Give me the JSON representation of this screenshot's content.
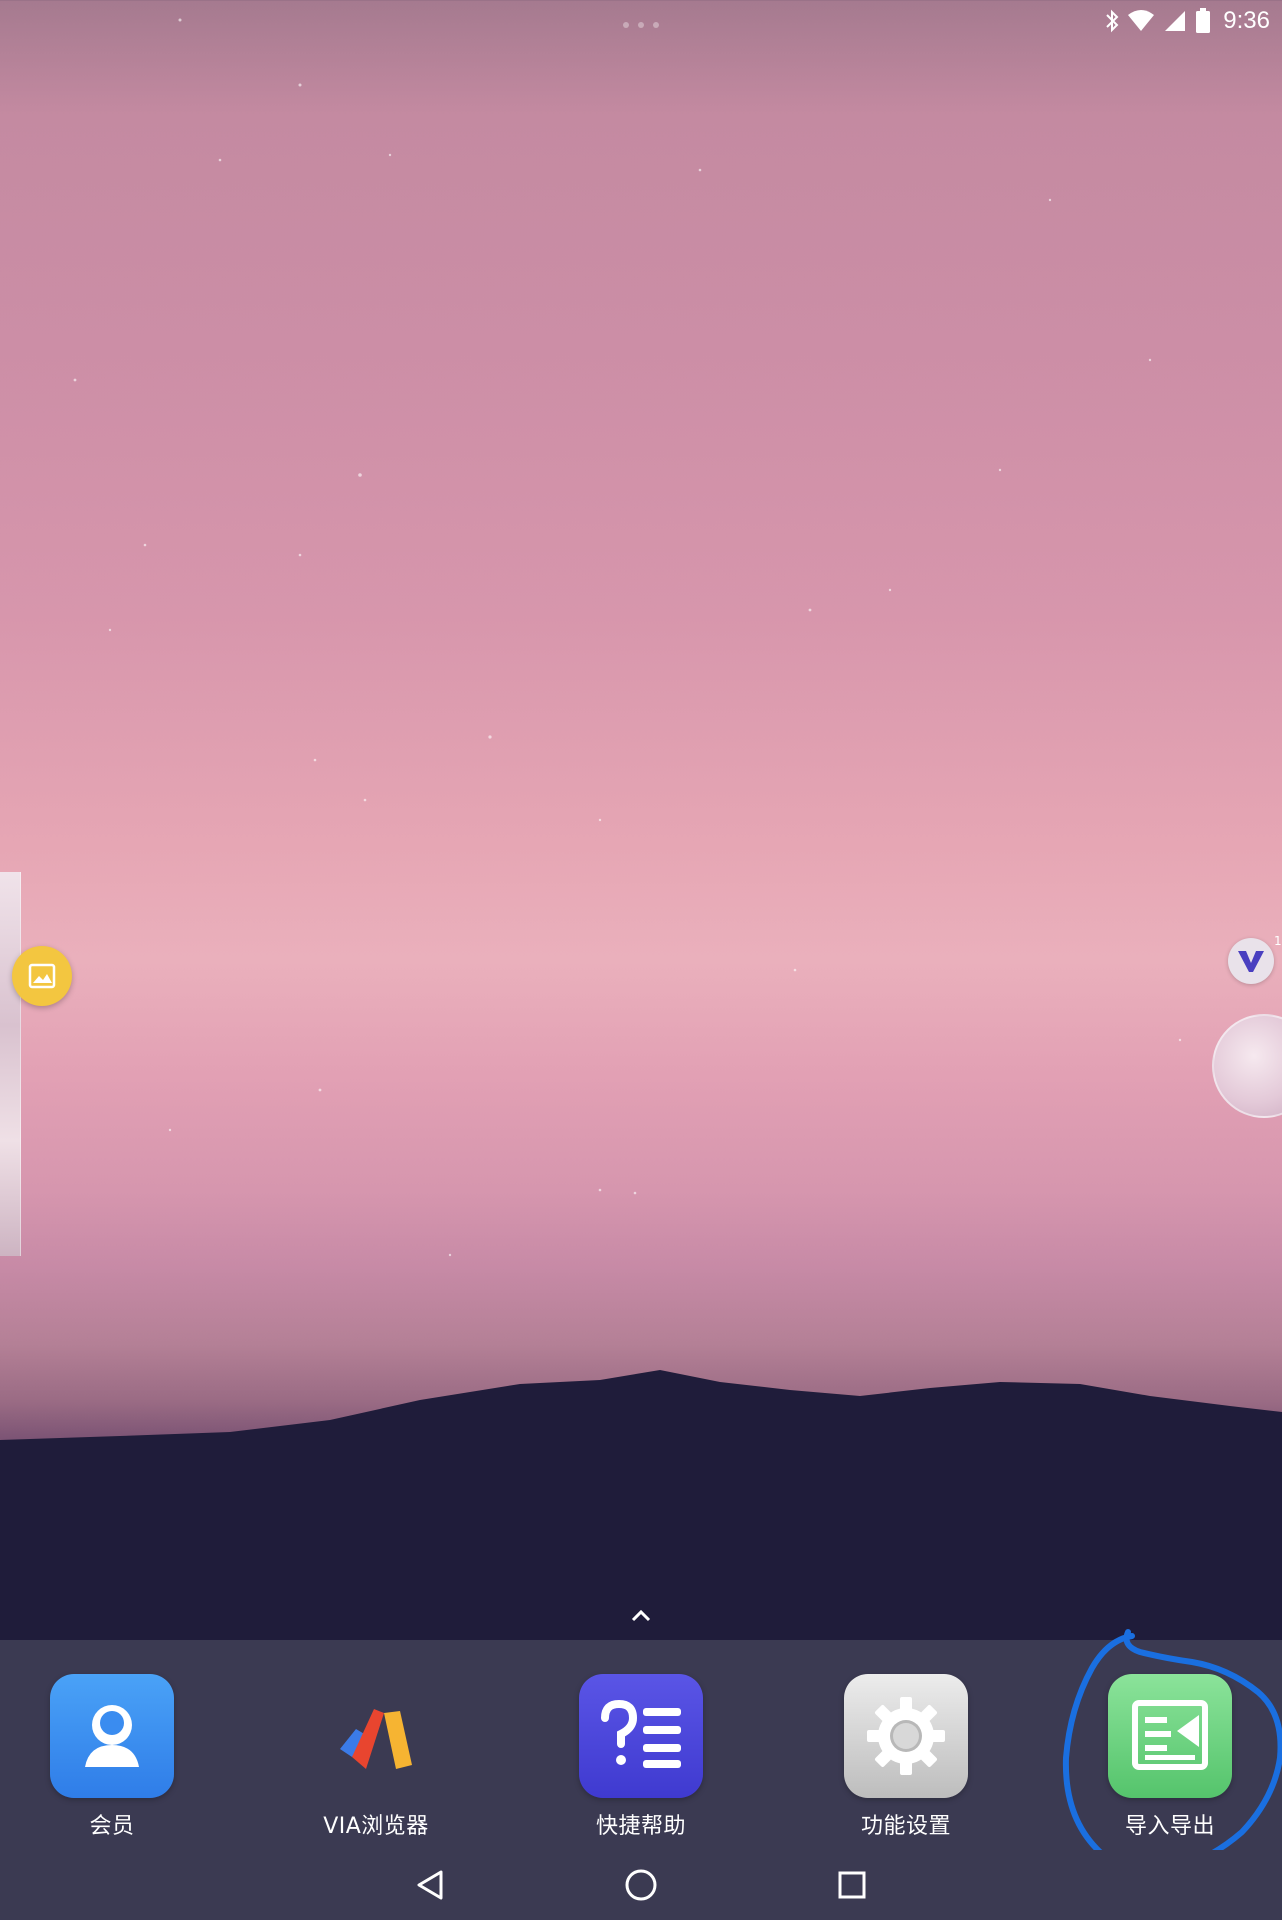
{
  "status_bar": {
    "time": "9:36",
    "icons": [
      "bluetooth-icon",
      "wifi-icon",
      "cell-signal-icon",
      "battery-icon"
    ]
  },
  "edge_widgets": {
    "left_floating": "gallery-icon",
    "right_floating": [
      "v-app-icon",
      "avatar"
    ],
    "v_badge": "1"
  },
  "drawer_handle_icon": "chevron-up-icon",
  "dock": {
    "items": [
      {
        "label": "会员",
        "icon": "member-icon"
      },
      {
        "label": "VIA浏览器",
        "icon": "via-browser-icon"
      },
      {
        "label": "快捷帮助",
        "icon": "help-icon"
      },
      {
        "label": "功能设置",
        "icon": "gear-icon"
      },
      {
        "label": "导入导出",
        "icon": "import-export-icon",
        "highlighted": true
      }
    ]
  },
  "nav_bar": {
    "buttons": [
      "back-icon",
      "home-icon",
      "recents-icon"
    ]
  },
  "colors": {
    "dock_bg": "#3b3a52",
    "highlight_stroke": "#1a6fe0"
  }
}
